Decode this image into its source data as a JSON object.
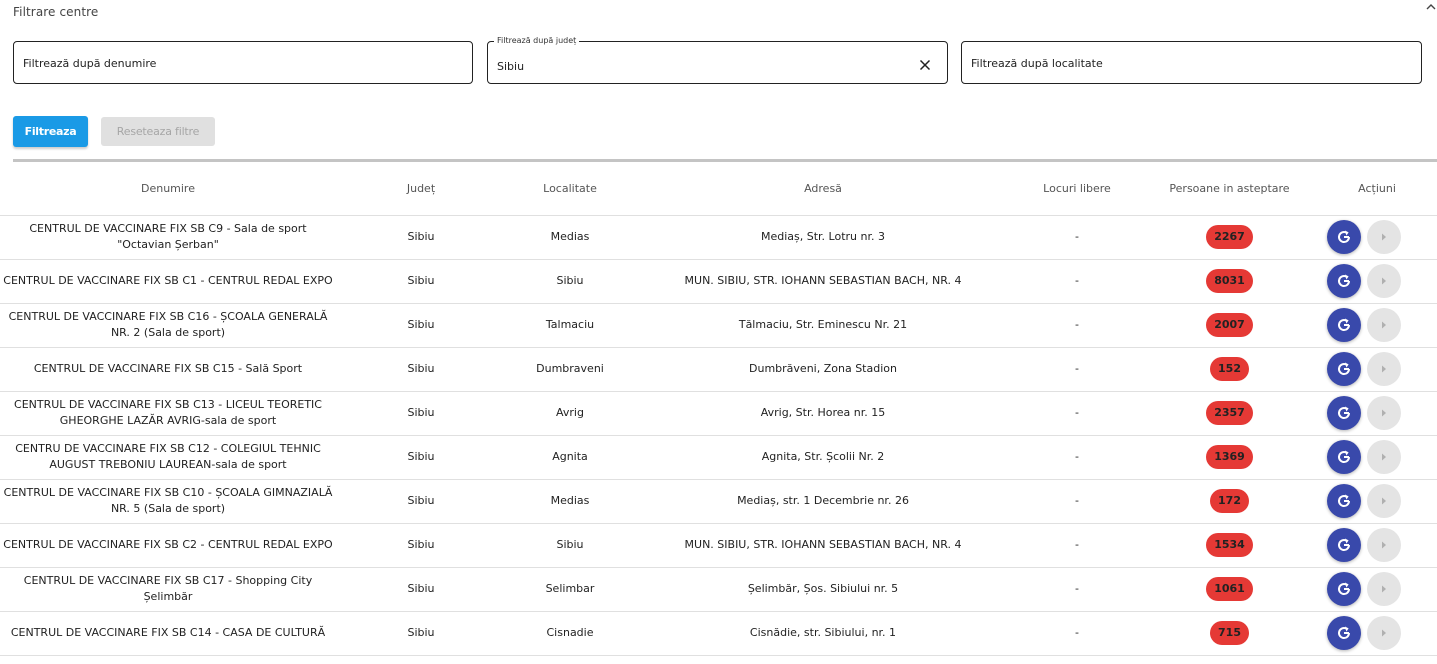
{
  "filter": {
    "title": "Filtrare centre",
    "name_placeholder": "Filtrează după denumire",
    "county_label": "Filtrează după județ",
    "county_value": "Sibiu",
    "locality_placeholder": "Filtrează după localitate",
    "filter_button": "Filtreaza",
    "reset_button": "Reseteaza filtre"
  },
  "table": {
    "headers": [
      "Denumire",
      "Județ",
      "Localitate",
      "Adresă",
      "Locuri libere",
      "Persoane in asteptare",
      "Acțiuni"
    ],
    "rows": [
      {
        "name": "CENTRUL DE VACCINARE FIX SB C9 - Sala de sport \"Octavian Șerban\"",
        "county": "Sibiu",
        "locality": "Medias",
        "address": "Mediaș, Str. Lotru nr. 3",
        "free": "-",
        "waiting": "2267"
      },
      {
        "name": "CENTRUL DE VACCINARE FIX SB C1 - CENTRUL REDAL EXPO",
        "county": "Sibiu",
        "locality": "Sibiu",
        "address": "MUN. SIBIU, STR. IOHANN SEBASTIAN BACH, NR. 4",
        "free": "-",
        "waiting": "8031"
      },
      {
        "name": "CENTRUL DE VACCINARE FIX SB C16 - ȘCOALA GENERALĂ NR. 2 (Sala de sport)",
        "county": "Sibiu",
        "locality": "Talmaciu",
        "address": "Tălmaciu, Str. Eminescu Nr. 21",
        "free": "-",
        "waiting": "2007"
      },
      {
        "name": "CENTRUL DE VACCINARE FIX SB C15 - Sală Sport",
        "county": "Sibiu",
        "locality": "Dumbraveni",
        "address": "Dumbrăveni, Zona Stadion",
        "free": "-",
        "waiting": "152"
      },
      {
        "name": "CENTRUL DE VACCINARE FIX SB C13 - LICEUL TEORETIC GHEORGHE LAZĂR AVRIG-sala de sport",
        "county": "Sibiu",
        "locality": "Avrig",
        "address": "Avrig, Str. Horea nr. 15",
        "free": "-",
        "waiting": "2357"
      },
      {
        "name": "CENTRU DE VACCINARE FIX SB C12 - COLEGIUL TEHNIC AUGUST TREBONIU LAUREAN-sala de sport",
        "county": "Sibiu",
        "locality": "Agnita",
        "address": "Agnita, Str. Școlii Nr. 2",
        "free": "-",
        "waiting": "1369"
      },
      {
        "name": "CENTRUL DE VACCINARE FIX SB C10 - ȘCOALA GIMNAZIALĂ NR. 5 (Sala de sport)",
        "county": "Sibiu",
        "locality": "Medias",
        "address": "Mediaș, str. 1 Decembrie nr. 26",
        "free": "-",
        "waiting": "172"
      },
      {
        "name": "CENTRUL DE VACCINARE FIX SB C2 - CENTRUL REDAL EXPO",
        "county": "Sibiu",
        "locality": "Sibiu",
        "address": "MUN. SIBIU, STR. IOHANN SEBASTIAN BACH, NR. 4",
        "free": "-",
        "waiting": "1534"
      },
      {
        "name": "CENTRUL DE VACCINARE FIX SB C17 - Shopping City Șelimbăr",
        "county": "Sibiu",
        "locality": "Selimbar",
        "address": "Șelimbăr, Șos. Sibiului nr. 5",
        "free": "-",
        "waiting": "1061"
      },
      {
        "name": "CENTRUL DE VACCINARE FIX SB C14 - CASA DE CULTURĂ",
        "county": "Sibiu",
        "locality": "Cisnadie",
        "address": "Cisnădie, str. Sibiului, nr. 1",
        "free": "-",
        "waiting": "715"
      }
    ]
  },
  "icons": {
    "collapse": "chevron-up-icon",
    "clear": "close-icon",
    "refresh": "refresh-icon",
    "play": "play-arrow-icon"
  },
  "colors": {
    "primary": "#1a9ae6",
    "waiting_badge": "#e53935",
    "refresh_button": "#3949ab",
    "disabled": "#e0e0e0"
  }
}
